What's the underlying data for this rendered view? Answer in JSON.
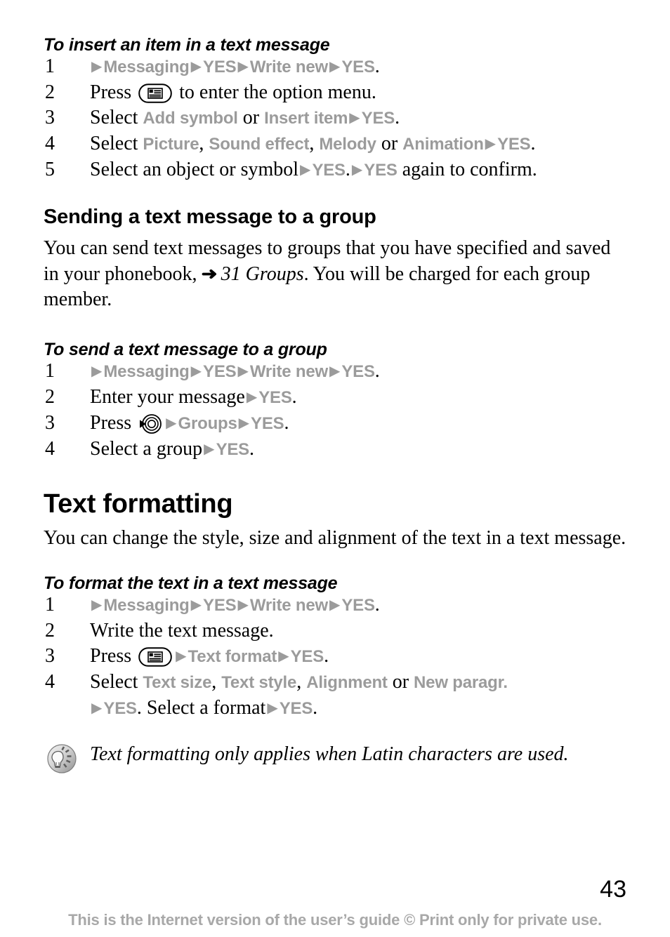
{
  "page": {
    "number": "43",
    "footer_note": "This is the Internet version of the user’s guide © Print only for private use."
  },
  "glyphs": {
    "step_arrow": "▶",
    "ref_arrow": "➜",
    "yes": "YES"
  },
  "colors": {
    "menu_gray": "#9b9b9b",
    "footer_gray": "#a8a8a8",
    "text_black": "#000000",
    "icon_gray": "#8c8c8c"
  },
  "sections": {
    "insert_item": {
      "heading": "To insert an item in a text message",
      "steps": [
        {
          "num": "1",
          "parts": [
            {
              "t": "arrow"
            },
            {
              "t": "menu",
              "v": "Messaging"
            },
            {
              "t": "arrow"
            },
            {
              "t": "menu",
              "v": "YES"
            },
            {
              "t": "arrow"
            },
            {
              "t": "menu",
              "v": "Write new"
            },
            {
              "t": "arrow"
            },
            {
              "t": "menu",
              "v": "YES"
            },
            {
              "t": "text",
              "v": "."
            }
          ]
        },
        {
          "num": "2",
          "parts": [
            {
              "t": "text",
              "v": "Press "
            },
            {
              "t": "icon",
              "v": "menu-key-icon"
            },
            {
              "t": "text",
              "v": " to enter the option menu."
            }
          ]
        },
        {
          "num": "3",
          "parts": [
            {
              "t": "text",
              "v": "Select "
            },
            {
              "t": "menu",
              "v": "Add symbol"
            },
            {
              "t": "text",
              "v": " or "
            },
            {
              "t": "menu",
              "v": "Insert item"
            },
            {
              "t": "arrow"
            },
            {
              "t": "menu",
              "v": "YES"
            },
            {
              "t": "text",
              "v": "."
            }
          ]
        },
        {
          "num": "4",
          "parts": [
            {
              "t": "text",
              "v": "Select "
            },
            {
              "t": "menu",
              "v": "Picture"
            },
            {
              "t": "text",
              "v": ", "
            },
            {
              "t": "menu",
              "v": "Sound effect"
            },
            {
              "t": "text",
              "v": ", "
            },
            {
              "t": "menu",
              "v": "Melody"
            },
            {
              "t": "text",
              "v": " or "
            },
            {
              "t": "menu",
              "v": "Animation"
            },
            {
              "t": "arrow"
            },
            {
              "t": "menu",
              "v": "YES"
            },
            {
              "t": "text",
              "v": "."
            }
          ]
        },
        {
          "num": "5",
          "parts": [
            {
              "t": "text",
              "v": "Select an object or symbol"
            },
            {
              "t": "arrow"
            },
            {
              "t": "menu",
              "v": "YES"
            },
            {
              "t": "text",
              "v": "."
            },
            {
              "t": "arrow"
            },
            {
              "t": "menu",
              "v": "YES"
            },
            {
              "t": "text",
              "v": " again to confirm."
            }
          ]
        }
      ]
    },
    "sending_group": {
      "heading": "Sending a text message to a group",
      "body_parts": [
        {
          "t": "text",
          "v": "You can send text messages to groups that you have specified and saved in your phonebook, "
        },
        {
          "t": "refarrow"
        },
        {
          "t": "italic",
          "v": " 31 Groups"
        },
        {
          "t": "text",
          "v": ". You will be charged for each group member."
        }
      ]
    },
    "send_to_group": {
      "heading": "To send a text message to a group",
      "steps": [
        {
          "num": "1",
          "parts": [
            {
              "t": "arrow"
            },
            {
              "t": "menu",
              "v": "Messaging"
            },
            {
              "t": "arrow"
            },
            {
              "t": "menu",
              "v": "YES"
            },
            {
              "t": "arrow"
            },
            {
              "t": "menu",
              "v": "Write new"
            },
            {
              "t": "arrow"
            },
            {
              "t": "menu",
              "v": "YES"
            },
            {
              "t": "text",
              "v": "."
            }
          ]
        },
        {
          "num": "2",
          "parts": [
            {
              "t": "text",
              "v": "Enter your message"
            },
            {
              "t": "arrow"
            },
            {
              "t": "menu",
              "v": "YES"
            },
            {
              "t": "text",
              "v": "."
            }
          ]
        },
        {
          "num": "3",
          "parts": [
            {
              "t": "text",
              "v": "Press "
            },
            {
              "t": "icon",
              "v": "joystick-key-icon"
            },
            {
              "t": "arrow"
            },
            {
              "t": "menu",
              "v": "Groups"
            },
            {
              "t": "arrow"
            },
            {
              "t": "menu",
              "v": "YES"
            },
            {
              "t": "text",
              "v": "."
            }
          ]
        },
        {
          "num": "4",
          "parts": [
            {
              "t": "text",
              "v": "Select a group"
            },
            {
              "t": "arrow"
            },
            {
              "t": "menu",
              "v": "YES"
            },
            {
              "t": "text",
              "v": "."
            }
          ]
        }
      ]
    },
    "text_formatting": {
      "heading": "Text formatting",
      "body": "You can change the style, size and alignment of the text in a text message."
    },
    "format_text": {
      "heading": "To format the text in a text message",
      "steps": [
        {
          "num": "1",
          "parts": [
            {
              "t": "arrow"
            },
            {
              "t": "menu",
              "v": "Messaging"
            },
            {
              "t": "arrow"
            },
            {
              "t": "menu",
              "v": "YES"
            },
            {
              "t": "arrow"
            },
            {
              "t": "menu",
              "v": "Write new"
            },
            {
              "t": "arrow"
            },
            {
              "t": "menu",
              "v": "YES"
            },
            {
              "t": "text",
              "v": "."
            }
          ]
        },
        {
          "num": "2",
          "parts": [
            {
              "t": "text",
              "v": "Write the text message."
            }
          ]
        },
        {
          "num": "3",
          "parts": [
            {
              "t": "text",
              "v": "Press "
            },
            {
              "t": "icon",
              "v": "menu-key-icon"
            },
            {
              "t": "arrow"
            },
            {
              "t": "menu",
              "v": "Text format"
            },
            {
              "t": "arrow"
            },
            {
              "t": "menu",
              "v": "YES"
            },
            {
              "t": "text",
              "v": "."
            }
          ]
        },
        {
          "num": "4",
          "parts": [
            {
              "t": "text",
              "v": "Select "
            },
            {
              "t": "menu",
              "v": "Text size"
            },
            {
              "t": "text",
              "v": ", "
            },
            {
              "t": "menu",
              "v": "Text style"
            },
            {
              "t": "text",
              "v": ", "
            },
            {
              "t": "menu",
              "v": "Alignment"
            },
            {
              "t": "text",
              "v": " or "
            },
            {
              "t": "menu",
              "v": "New paragr."
            },
            {
              "t": "break"
            },
            {
              "t": "arrow"
            },
            {
              "t": "menu",
              "v": "YES"
            },
            {
              "t": "text",
              "v": ". Select a format"
            },
            {
              "t": "arrow"
            },
            {
              "t": "menu",
              "v": "YES"
            },
            {
              "t": "text",
              "v": "."
            }
          ]
        }
      ]
    },
    "tip_note": {
      "icon": "tip-bulb-icon",
      "text": "Text formatting only applies when Latin characters are used."
    }
  }
}
